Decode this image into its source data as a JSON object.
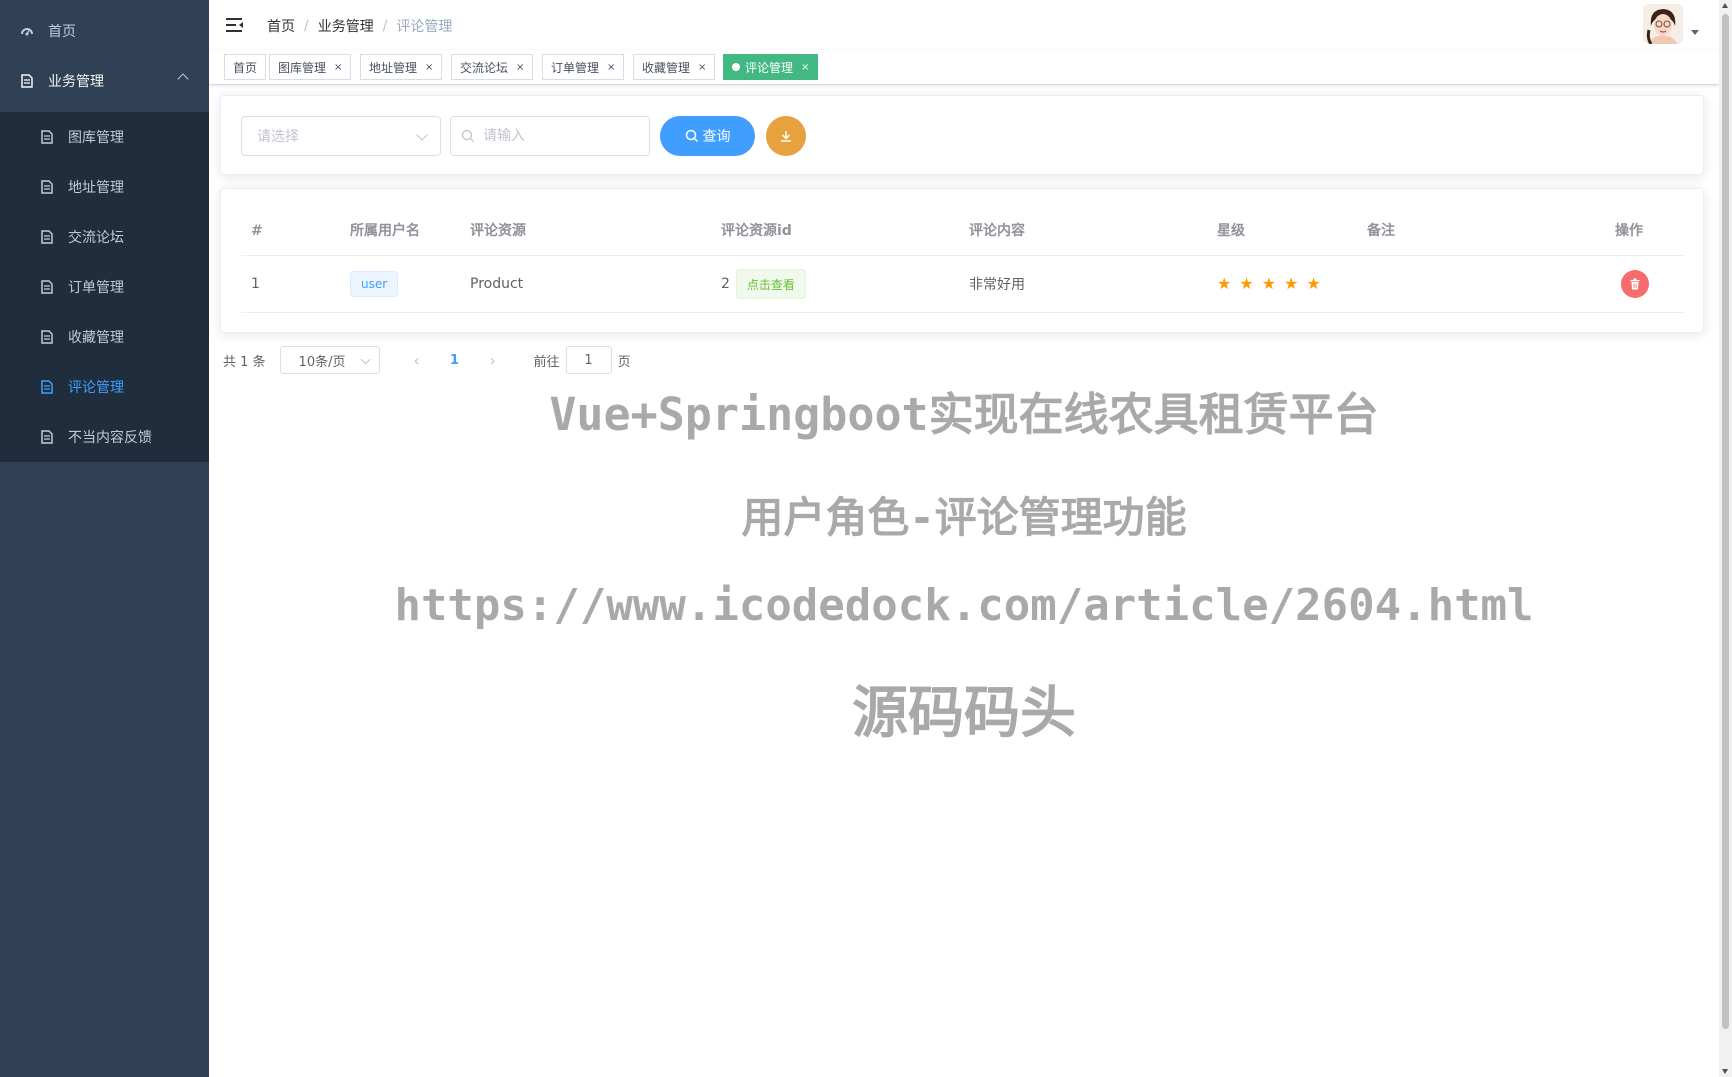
{
  "sidebar": {
    "home": {
      "label": "首页",
      "icon": "dashboard-icon"
    },
    "group": {
      "label": "业务管理",
      "icon": "document-icon"
    },
    "items": [
      {
        "label": "图库管理",
        "icon": "document-icon",
        "active": false
      },
      {
        "label": "地址管理",
        "icon": "document-icon",
        "active": false
      },
      {
        "label": "交流论坛",
        "icon": "document-icon",
        "active": false
      },
      {
        "label": "订单管理",
        "icon": "document-icon",
        "active": false
      },
      {
        "label": "收藏管理",
        "icon": "document-icon",
        "active": false
      },
      {
        "label": "评论管理",
        "icon": "document-icon",
        "active": true
      },
      {
        "label": "不当内容反馈",
        "icon": "document-icon",
        "active": false
      }
    ]
  },
  "header": {
    "breadcrumb": [
      "首页",
      "业务管理",
      "评论管理"
    ],
    "separator": "/"
  },
  "tags": [
    {
      "label": "首页",
      "closable": false,
      "active": false
    },
    {
      "label": "图库管理",
      "closable": true,
      "active": false
    },
    {
      "label": "地址管理",
      "closable": true,
      "active": false
    },
    {
      "label": "交流论坛",
      "closable": true,
      "active": false
    },
    {
      "label": "订单管理",
      "closable": true,
      "active": false
    },
    {
      "label": "收藏管理",
      "closable": true,
      "active": false
    },
    {
      "label": "评论管理",
      "closable": true,
      "active": true
    }
  ],
  "tag_close_glyph": "×",
  "search": {
    "select_placeholder": "请选择",
    "input_placeholder": "请输入",
    "search_button": "查询",
    "download_icon": "download-icon"
  },
  "table": {
    "columns": [
      "#",
      "所属用户名",
      "评论资源",
      "评论资源id",
      "评论内容",
      "星级",
      "备注",
      "操作"
    ],
    "rows": [
      {
        "index": "1",
        "username": "user",
        "resource": "Product",
        "resource_id": "2",
        "view_label": "点击查看",
        "content": "非常好用",
        "rating": 5,
        "remark": "",
        "action_icon": "trash-icon"
      }
    ],
    "star_glyph": "★"
  },
  "pagination": {
    "total": "共 1 条",
    "page_size": "10条/页",
    "current_page": "1",
    "jump_prefix": "前往",
    "jump_value": "1",
    "jump_suffix": "页",
    "prev_glyph": "‹",
    "next_glyph": "›"
  },
  "watermark": {
    "line1": "Vue+Springboot实现在线农具租赁平台",
    "line2": "用户角色-评论管理功能",
    "line3": "https://www.icodedock.com/article/2604.html",
    "line4": "源码码头"
  },
  "colors": {
    "sidebar_bg": "#304156",
    "submenu_bg": "#1f2d3d",
    "primary": "#409eff",
    "tag_active": "#42b983",
    "warning": "#e6a23c",
    "danger": "#f56c6c",
    "star": "#ff9900"
  }
}
